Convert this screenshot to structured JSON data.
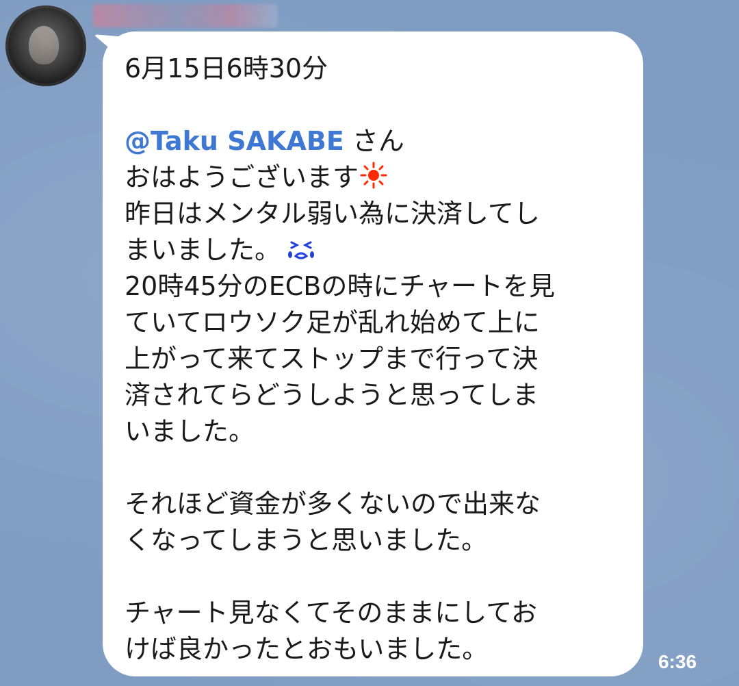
{
  "sender": {
    "name": ""
  },
  "message": {
    "date_line": "6月15日6時30分",
    "mention": "@Taku SAKABE",
    "mention_suffix": " さん",
    "greeting": "おはようございます",
    "greeting_icon": "sun-icon",
    "line_1": "昨日はメンタル弱い為に決済してし",
    "line_2": "まいました。",
    "line_2_icon": "crying-face-icon",
    "line_3": "20時45分のECBの時にチャートを見",
    "line_4": "ていてロウソク足が乱れ始めて上に",
    "line_5": "上がって来てストップまで行って決",
    "line_6": "済されてらどうしようと思ってしま",
    "line_7": "いました。",
    "line_8": "それほど資金が多くないので出来な",
    "line_9": "くなってしまうと思いました。",
    "line_10": "チャート見なくてそのままにしてお",
    "line_11": "けば良かったとおもいました。"
  },
  "timestamp": "6:36",
  "colors": {
    "background": "#7f9cc2",
    "bubble": "#ffffff",
    "mention": "#3e78d2",
    "text": "#1a1a1a",
    "sun": "#ff2a00",
    "crying_face": "#1f3fe0"
  }
}
